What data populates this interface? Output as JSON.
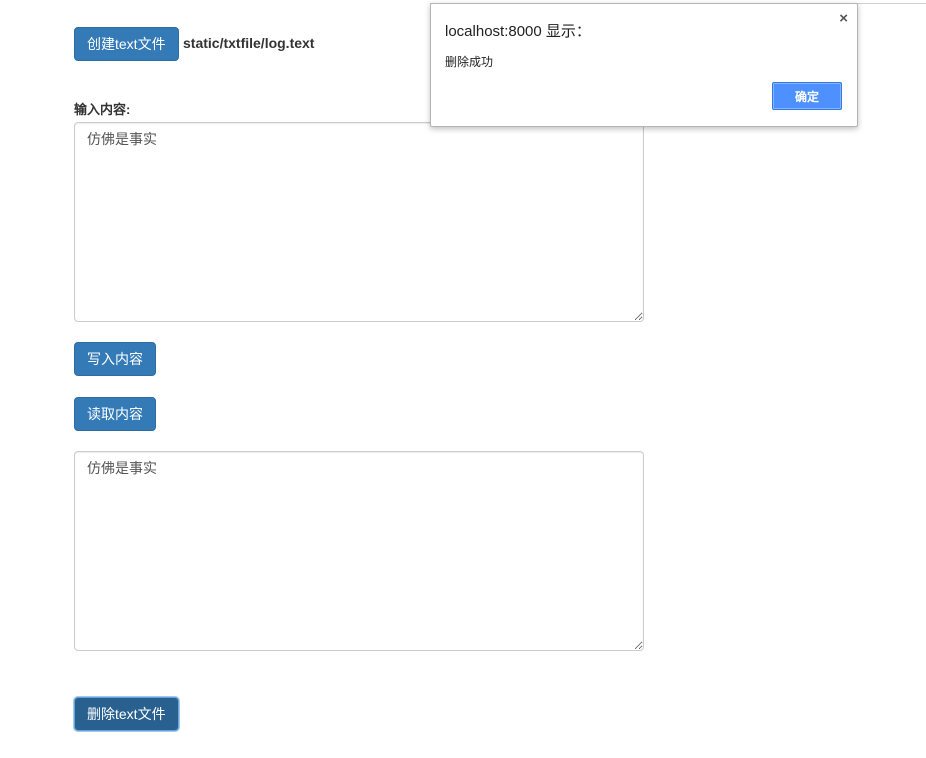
{
  "toolbar": {
    "create_label": "创建text文件",
    "file_path": "static/txtfile/log.text"
  },
  "form": {
    "input_label": "输入内容:",
    "input_value": "仿佛是事实",
    "write_label": "写入内容",
    "read_label": "读取内容",
    "output_value": "仿佛是事实",
    "delete_label": "删除text文件"
  },
  "dialog": {
    "title": "localhost:8000 显示：",
    "message": "删除成功",
    "ok_label": "确定",
    "close_glyph": "×"
  },
  "colors": {
    "primary": "#337ab7",
    "primary_active": "#286090",
    "dialog_ok": "#4d90fe"
  }
}
